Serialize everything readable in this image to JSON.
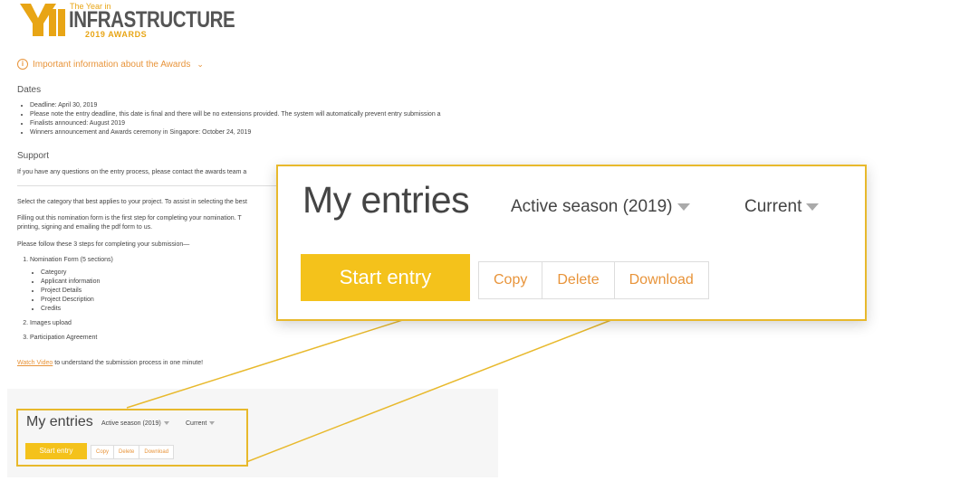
{
  "logo": {
    "line1": "The Year in",
    "line2": "INFRASTRUCTURE",
    "line3": "2019 AWARDS"
  },
  "info_toggle": {
    "label": "Important information about the Awards"
  },
  "dates": {
    "heading": "Dates",
    "items": [
      "Deadline: April 30, 2019",
      "Please note the entry deadline, this date is final and there will be no extensions provided. The system will automatically prevent entry submission a",
      "Finalists announced: August 2019",
      "Winners announcement and Awards ceremony in Singapore: October 24, 2019"
    ]
  },
  "support": {
    "heading": "Support",
    "text": "If you have any questions on the entry process, please contact the awards team a"
  },
  "body": {
    "select_text": "Select the category that best applies to your project. To assist in selecting the best",
    "filling_line1": "Filling out this nomination form is the first step for completing your nomination. T",
    "filling_line2": "printing, signing and emailing the pdf form to us.",
    "follow_text": "Please follow these 3 steps for completing your submission—"
  },
  "steps": [
    {
      "label": "Nomination Form (5 sections)",
      "sub": [
        "Category",
        "Applicant information",
        "Project Details",
        "Project Description",
        "Credits"
      ]
    },
    {
      "label": "Images upload",
      "sub": []
    },
    {
      "label": "Participation Agreement",
      "sub": []
    }
  ],
  "watch": {
    "link": "Watch Video",
    "rest": " to understand the submission process in one minute!"
  },
  "entries": {
    "title": "My entries",
    "season": "Active season (2019)",
    "filter": "Current",
    "start_label": "Start entry",
    "copy_label": "Copy",
    "delete_label": "Delete",
    "download_label": "Download"
  },
  "colors": {
    "accent": "#F4C21B",
    "highlight_border": "#E8B92C",
    "link_orange": "#E8943A"
  }
}
